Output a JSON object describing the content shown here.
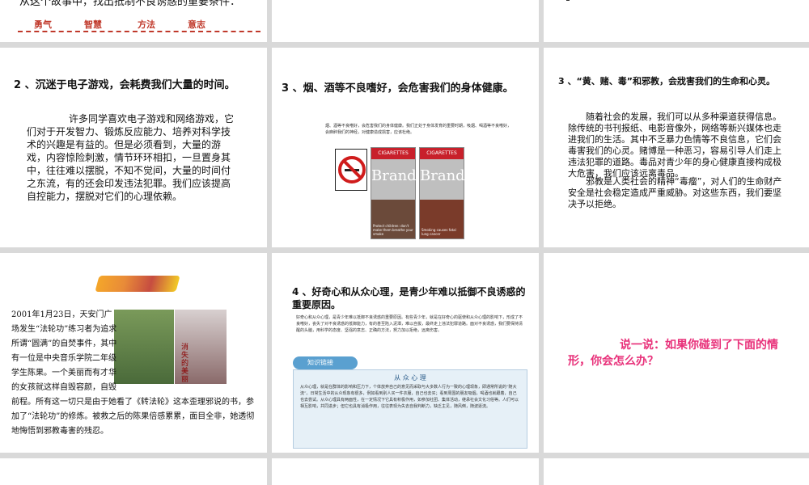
{
  "s1": {
    "line": "从这个故事中，找出抵制不良诱惑的重要条件：",
    "answers": [
      "勇气",
      "智慧",
      "方法",
      "意志"
    ]
  },
  "s4": {
    "title": "2 、沉迷于电子游戏，会耗费我们大量的时间。",
    "body": "许多同学喜欢电子游戏和网络游戏，它们对于开发智力、锻炼反应能力、培养对科学技术的兴趣是有益的。但是必须看到，大量的游戏，内容惊险刺激，情节环环相扣，一旦置身其中，往往难以摆脱，不知不觉间，大量的时间付之东流，有的还会印发违法犯罪。我们应该提高自控能力，摆脱对它们的心理依赖。"
  },
  "s5": {
    "title": "3 、烟、酒等不良嗜好，会危害我们的身体健康。",
    "caption": "烟、酒等不良嗜好，会危害我们的身体健康。我们正处于身体发育的重要时期，吸烟、喝酒等不良嗜好，会麻醉我们的神经，对健康造成损害，应该杜绝。",
    "pack_band": "CIGARETTES",
    "pack_brand": "Brand",
    "pack1_warn": "Protect children: don't make them breathe your smoke",
    "pack2_warn": "Smoking causes fatal lung cancer"
  },
  "s6": {
    "title": "3 、“黄、赌、毒”和邪教，会戕害我们的生命和心灵。",
    "p1": "随着社会的发展，我们可以从多种渠道获得信息。除传统的书刊报纸、电影音像外，网络等新兴媒体也走进我们的生活。其中不乏暴力色情等不良信息，它们会毒害我们的心灵。赌博是一种恶习，容易引导人们走上违法犯罪的道路。毒品对青少年的身心健康直接构成极大危害，我们应该远离毒品。",
    "p2": "邪教是人类社会的精神“毒瘤”，对人们的生命财产安全是社会稳定造成严重威胁。对这些东西，我们要坚决予以拒绝。"
  },
  "s7": {
    "story": "2001年1月23日，天安门广场发生“法轮功”练习者为追求所谓“圆满”的自焚事件，其中有一位是中央音乐学院二年级学生陈果。一个美丽而有才华的女孩就这样自毁容颜，自毁前程。所有这一切只是由于她看了《转法轮》这本歪理邪说的书，参加了“法轮功”的修炼。被救之后的陈果倍感累累，面目全非，她透彻地悔悟到邪教毒害的残忍。",
    "photo_label": "消失的美丽"
  },
  "s8": {
    "title": "4 、好奇心和从众心理，是青少年难以抵御不良诱惑的重要原因。",
    "para": "好奇心和从众心理，是青少年难以抵御不良诱惑的重要原因。有些青少年，就是在好奇心的驱使和从众心理的影响下，形成了不良嗜好，丧失了对不良诱惑的抵御能力，有的甚至陷入泥潭，难以自拔，最终走上违法犯罪道路。面对不良诱惑，我们要保持清醒的头脑，用科学的态度、坚强的意志、正确的方法，努力加以拒绝，远离伤害。",
    "link_label": "知识链接",
    "box_title": "从 众 心 理",
    "box_text": "从众心理，就是在群体的影响和压力下，个体放弃自己的意见而采取与大多数人行为一致的心理现象，即通常所说的“随大流”。日常生活中的从众现象有很多，例如看到别人买一件衣服，自己也去买；看到周围的朋友吸烟，喝酒也就跟着，自己也去尝试。从众心理具有两面性，在一定情况下它具有积极作用，如参加社团、集体活动，继承社会文化习俗等。人们可以相互影响，共同进步；但它也具有消极作用，往往表现为失去自我判断力，缺乏主见，随风倒，随波逐流。"
  },
  "s9": {
    "prompt": "说一说：如果你碰到了下面的情形，你会怎么办？"
  },
  "colors": {
    "background": "#d9d9d9",
    "answer_red": "#c0392b",
    "prompt_pink": "#e8317a",
    "box_blue": "#e6f0f7"
  }
}
